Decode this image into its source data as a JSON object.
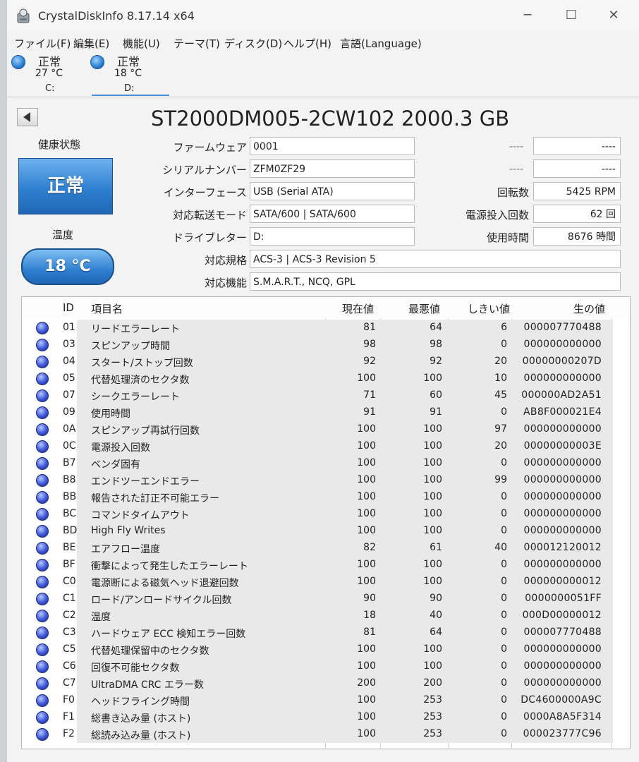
{
  "window": {
    "title": "CrystalDiskInfo 8.17.14 x64",
    "minimize": "─",
    "maximize": "☐",
    "close": "✕"
  },
  "menu": [
    "ファイル(F)",
    "編集(E)",
    "機能(U)",
    "テーマ(T)",
    "ディスク(D)",
    "ヘルプ(H)",
    "言語(Language)"
  ],
  "disks": [
    {
      "status": "正常",
      "temp": "27 °C",
      "drive": "C:"
    },
    {
      "status": "正常",
      "temp": "18 °C",
      "drive": "D:"
    }
  ],
  "header": {
    "model": "ST2000DM005-2CW102 2000.3 GB"
  },
  "health": {
    "label": "健康状態",
    "status": "正常"
  },
  "temperature": {
    "label": "温度",
    "value": "18 °C"
  },
  "fields": {
    "firmware": {
      "label": "ファームウェア",
      "value": "0001"
    },
    "serial": {
      "label": "シリアルナンバー",
      "value": "ZFM0ZF29"
    },
    "interface": {
      "label": "インターフェース",
      "value": "USB (Serial ATA)"
    },
    "transfer": {
      "label": "対応転送モード",
      "value": "SATA/600 | SATA/600"
    },
    "drive_letter": {
      "label": "ドライブレター",
      "value": "D:"
    },
    "standard": {
      "label": "対応規格",
      "value": "ACS-3 | ACS-3 Revision 5"
    },
    "features": {
      "label": "対応機能",
      "value": "S.M.A.R.T., NCQ, GPL"
    }
  },
  "right_fields": {
    "blank1": {
      "label": "----",
      "value": "----"
    },
    "blank2": {
      "label": "----",
      "value": "----"
    },
    "rotation": {
      "label": "回転数",
      "value": "5425 RPM"
    },
    "power_count": {
      "label": "電源投入回数",
      "value": "62 回"
    },
    "power_hours": {
      "label": "使用時間",
      "value": "8676 時間"
    }
  },
  "table": {
    "headers": {
      "id": "ID",
      "name": "項目名",
      "current": "現在値",
      "worst": "最悪値",
      "threshold": "しきい値",
      "raw": "生の値"
    },
    "rows": [
      {
        "id": "01",
        "name": "リードエラーレート",
        "current": "81",
        "worst": "64",
        "threshold": "6",
        "raw": "000007770488"
      },
      {
        "id": "03",
        "name": "スピンアップ時間",
        "current": "98",
        "worst": "98",
        "threshold": "0",
        "raw": "000000000000"
      },
      {
        "id": "04",
        "name": "スタート/ストップ回数",
        "current": "92",
        "worst": "92",
        "threshold": "20",
        "raw": "00000000207D"
      },
      {
        "id": "05",
        "name": "代替処理済のセクタ数",
        "current": "100",
        "worst": "100",
        "threshold": "10",
        "raw": "000000000000"
      },
      {
        "id": "07",
        "name": "シークエラーレート",
        "current": "71",
        "worst": "60",
        "threshold": "45",
        "raw": "000000AD2A51"
      },
      {
        "id": "09",
        "name": "使用時間",
        "current": "91",
        "worst": "91",
        "threshold": "0",
        "raw": "AB8F000021E4"
      },
      {
        "id": "0A",
        "name": "スピンアップ再試行回数",
        "current": "100",
        "worst": "100",
        "threshold": "97",
        "raw": "000000000000"
      },
      {
        "id": "0C",
        "name": "電源投入回数",
        "current": "100",
        "worst": "100",
        "threshold": "20",
        "raw": "00000000003E"
      },
      {
        "id": "B7",
        "name": "ベンダ固有",
        "current": "100",
        "worst": "100",
        "threshold": "0",
        "raw": "000000000000"
      },
      {
        "id": "B8",
        "name": "エンドツーエンドエラー",
        "current": "100",
        "worst": "100",
        "threshold": "99",
        "raw": "000000000000"
      },
      {
        "id": "BB",
        "name": "報告された訂正不可能エラー",
        "current": "100",
        "worst": "100",
        "threshold": "0",
        "raw": "000000000000"
      },
      {
        "id": "BC",
        "name": "コマンドタイムアウト",
        "current": "100",
        "worst": "100",
        "threshold": "0",
        "raw": "000000000000"
      },
      {
        "id": "BD",
        "name": "High Fly Writes",
        "current": "100",
        "worst": "100",
        "threshold": "0",
        "raw": "000000000000"
      },
      {
        "id": "BE",
        "name": "エアフロー温度",
        "current": "82",
        "worst": "61",
        "threshold": "40",
        "raw": "000012120012"
      },
      {
        "id": "BF",
        "name": "衝撃によって発生したエラーレート",
        "current": "100",
        "worst": "100",
        "threshold": "0",
        "raw": "000000000000"
      },
      {
        "id": "C0",
        "name": "電源断による磁気ヘッド退避回数",
        "current": "100",
        "worst": "100",
        "threshold": "0",
        "raw": "000000000012"
      },
      {
        "id": "C1",
        "name": "ロード/アンロードサイクル回数",
        "current": "90",
        "worst": "90",
        "threshold": "0",
        "raw": "0000000051FF"
      },
      {
        "id": "C2",
        "name": "温度",
        "current": "18",
        "worst": "40",
        "threshold": "0",
        "raw": "000D00000012"
      },
      {
        "id": "C3",
        "name": "ハードウェア ECC 検知エラー回数",
        "current": "81",
        "worst": "64",
        "threshold": "0",
        "raw": "000007770488"
      },
      {
        "id": "C5",
        "name": "代替処理保留中のセクタ数",
        "current": "100",
        "worst": "100",
        "threshold": "0",
        "raw": "000000000000"
      },
      {
        "id": "C6",
        "name": "回復不可能セクタ数",
        "current": "100",
        "worst": "100",
        "threshold": "0",
        "raw": "000000000000"
      },
      {
        "id": "C7",
        "name": "UltraDMA CRC エラー数",
        "current": "200",
        "worst": "200",
        "threshold": "0",
        "raw": "000000000000"
      },
      {
        "id": "F0",
        "name": "ヘッドフライング時間",
        "current": "100",
        "worst": "253",
        "threshold": "0",
        "raw": "DC4600000A9C"
      },
      {
        "id": "F1",
        "name": "総書き込み量 (ホスト)",
        "current": "100",
        "worst": "253",
        "threshold": "0",
        "raw": "0000A8A5F314"
      },
      {
        "id": "F2",
        "name": "総読み込み量 (ホスト)",
        "current": "100",
        "worst": "253",
        "threshold": "0",
        "raw": "000023777C96"
      }
    ]
  }
}
